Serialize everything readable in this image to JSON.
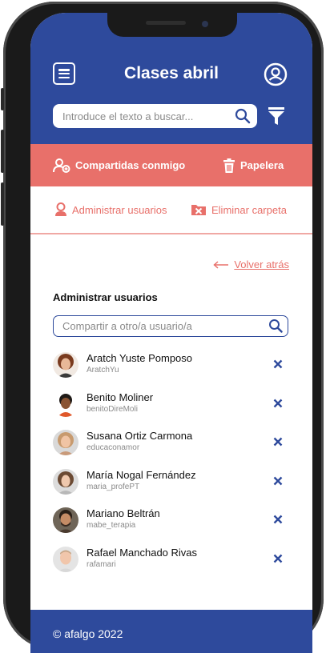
{
  "header": {
    "title": "Clases abril",
    "search_placeholder": "Introduce el texto a buscar..."
  },
  "tabs": {
    "shared": "Compartidas conmigo",
    "trash": "Papelera"
  },
  "actions": {
    "manage_users": "Administrar usuarios",
    "delete_folder": "Eliminar carpeta"
  },
  "back": {
    "label": "Volver atrás"
  },
  "manage": {
    "title": "Administrar usuarios",
    "share_placeholder": "Compartir a otro/a usuario/a"
  },
  "users": [
    {
      "name": "Aratch Yuste Pomposo",
      "handle": "AratchYu"
    },
    {
      "name": "Benito Moliner",
      "handle": "benitoDireMoli"
    },
    {
      "name": "Susana Ortiz Carmona",
      "handle": "educaconamor"
    },
    {
      "name": "María Nogal Fernández",
      "handle": "maria_profePT"
    },
    {
      "name": "Mariano Beltrán",
      "handle": "mabe_terapia"
    },
    {
      "name": "Rafael Manchado Rivas",
      "handle": "rafamari"
    }
  ],
  "footer": {
    "text": "© afalgo 2022"
  },
  "colors": {
    "primary": "#2e4a9c",
    "accent": "#e8706a",
    "accent_light": "#f0a8a4"
  },
  "icons": [
    "menu-icon",
    "user-circle-icon",
    "search-icon",
    "filter-icon",
    "users-shared-icon",
    "trash-icon",
    "user-icon",
    "delete-folder-icon",
    "arrow-left-icon",
    "close-icon"
  ]
}
